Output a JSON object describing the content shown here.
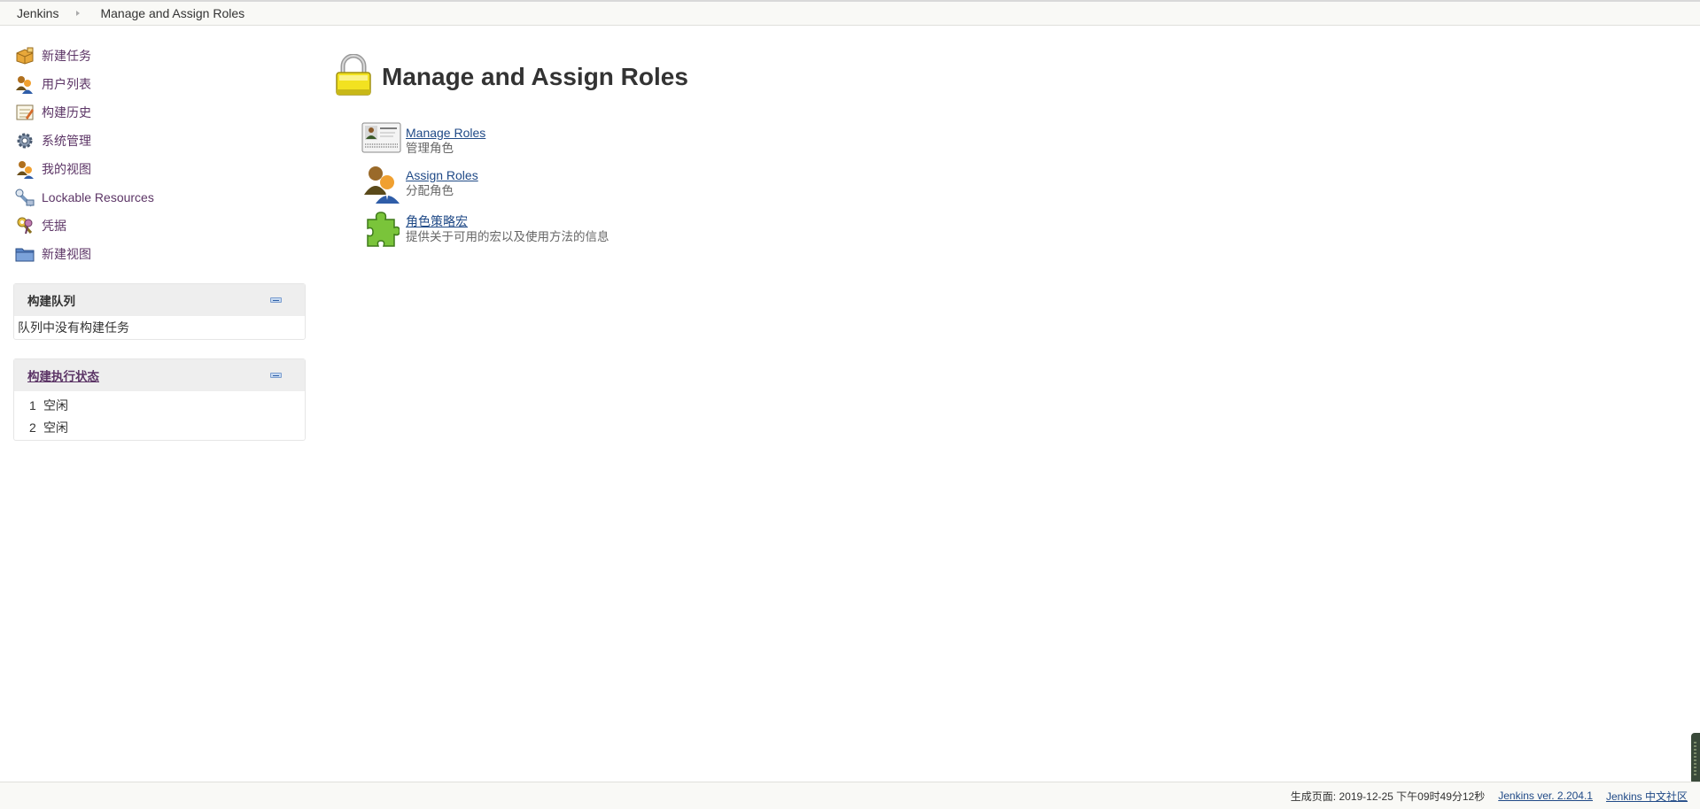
{
  "breadcrumb": {
    "root": "Jenkins",
    "current": "Manage and Assign Roles"
  },
  "sidebar": {
    "tasks": [
      {
        "label": "新建任务",
        "icon": "new-item-package-icon"
      },
      {
        "label": "用户列表",
        "icon": "people-icon"
      },
      {
        "label": "构建历史",
        "icon": "notepad-icon"
      },
      {
        "label": "系统管理",
        "icon": "gear-icon"
      },
      {
        "label": "我的视图",
        "icon": "user-icon"
      },
      {
        "label": "Lockable Resources",
        "icon": "lock-resource-icon"
      },
      {
        "label": "凭据",
        "icon": "keys-icon"
      },
      {
        "label": "新建视图",
        "icon": "folder-icon"
      }
    ],
    "queue": {
      "title": "构建队列",
      "empty_text": "队列中没有构建任务"
    },
    "executors": {
      "title": "构建执行状态",
      "rows": [
        {
          "num": "1",
          "status": "空闲"
        },
        {
          "num": "2",
          "status": "空闲"
        }
      ]
    }
  },
  "main": {
    "title": "Manage and Assign Roles",
    "items": [
      {
        "link": "Manage Roles",
        "desc": "管理角色",
        "icon": "id-card-icon"
      },
      {
        "link": "Assign Roles",
        "desc": "分配角色",
        "icon": "users-icon"
      },
      {
        "link": "角色策略宏",
        "desc": "提供关于可用的宏以及使用方法的信息",
        "icon": "puzzle-piece-icon"
      }
    ]
  },
  "footer": {
    "generated": "生成页面: 2019-12-25 下午09时49分12秒",
    "version_link": "Jenkins ver. 2.204.1",
    "community_link": "Jenkins 中文社区"
  }
}
